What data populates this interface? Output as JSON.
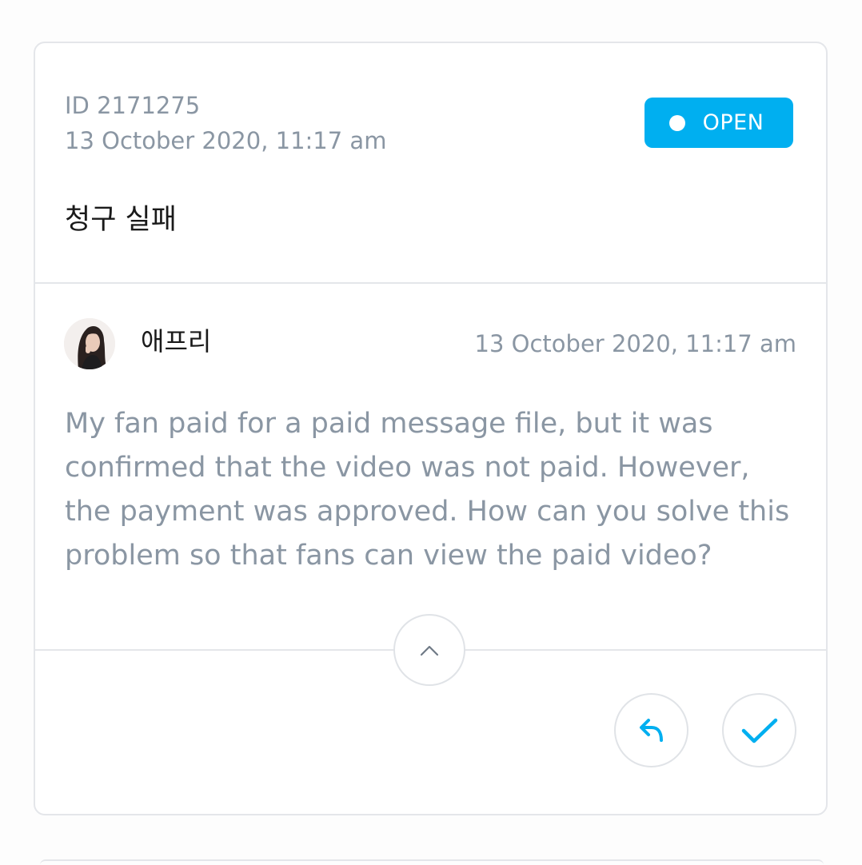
{
  "ticket": {
    "id_label": "ID 2171275",
    "created": "13 October 2020, 11:17 am",
    "status": "OPEN",
    "title": "청구 실패"
  },
  "message": {
    "author": "애프리",
    "timestamp": "13 October 2020, 11:17 am",
    "body": "My fan paid for a paid message file, but it was confirmed that the video was not paid. However, the payment was approved. How can you solve this problem so that fans can view the paid video?"
  },
  "icons": {
    "status": "status-dot-icon",
    "collapse": "chevron-up-icon",
    "reply": "reply-arrow-icon",
    "resolve": "checkmark-icon"
  },
  "colors": {
    "accent": "#00aff0",
    "muted_text": "#8a96a3",
    "primary_text": "#1a1a1a",
    "border": "#e4e6ea"
  }
}
